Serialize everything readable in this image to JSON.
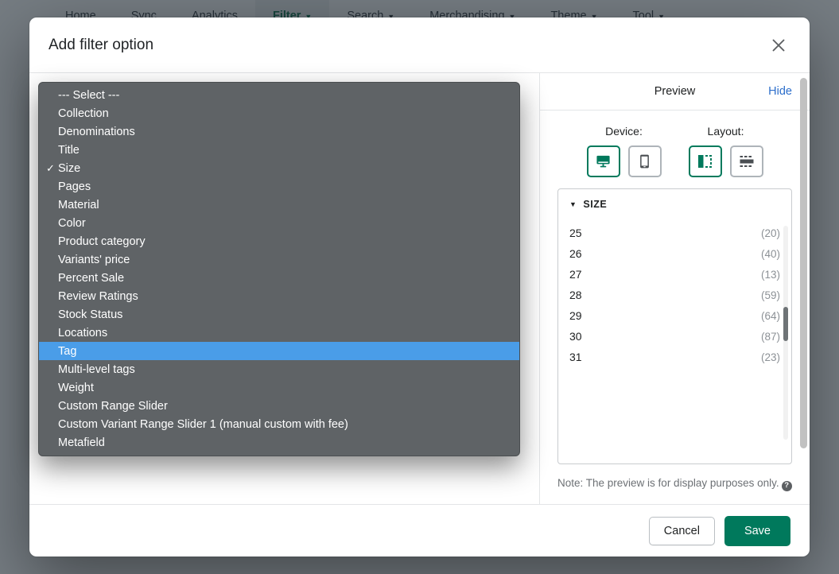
{
  "app": {
    "nav": [
      {
        "label": "Home",
        "has_caret": false,
        "active": false
      },
      {
        "label": "Sync",
        "has_caret": false,
        "active": false
      },
      {
        "label": "Analytics",
        "has_caret": false,
        "active": false
      },
      {
        "label": "Filter",
        "has_caret": true,
        "active": true
      },
      {
        "label": "Search",
        "has_caret": true,
        "active": false
      },
      {
        "label": "Merchandising",
        "has_caret": true,
        "active": false
      },
      {
        "label": "Theme",
        "has_caret": true,
        "active": false
      },
      {
        "label": "Tool",
        "has_caret": true,
        "active": false
      }
    ]
  },
  "modal": {
    "title": "Add filter option",
    "close_icon": "close-icon",
    "footer": {
      "cancel_label": "Cancel",
      "save_label": "Save"
    }
  },
  "dropdown": {
    "open": true,
    "selected": "Size",
    "highlighted": "Tag",
    "options": [
      "--- Select ---",
      "Collection",
      "Denominations",
      "Title",
      "Size",
      "Pages",
      "Material",
      "Color",
      "Product category",
      "Variants' price",
      "Percent Sale",
      "Review Ratings",
      "Stock Status",
      "Locations",
      "Tag",
      "Multi-level tags",
      "Weight",
      "Custom Range Slider",
      "Custom Variant Range Slider 1 (manual custom with fee)",
      "Metafield"
    ]
  },
  "preview": {
    "title": "Preview",
    "hide_label": "Hide",
    "device": {
      "label": "Device:",
      "options": [
        {
          "name": "desktop-icon",
          "selected": true
        },
        {
          "name": "mobile-icon",
          "selected": false
        }
      ]
    },
    "layout": {
      "label": "Layout:",
      "options": [
        {
          "name": "sidebar-layout-icon",
          "selected": true
        },
        {
          "name": "horizontal-layout-icon",
          "selected": false
        }
      ]
    },
    "facet": {
      "title": "SIZE",
      "expanded": true,
      "rows": [
        {
          "value": "25",
          "count": "(20)"
        },
        {
          "value": "26",
          "count": "(40)"
        },
        {
          "value": "27",
          "count": "(13)"
        },
        {
          "value": "28",
          "count": "(59)"
        },
        {
          "value": "29",
          "count": "(64)"
        },
        {
          "value": "30",
          "count": "(87)"
        },
        {
          "value": "31",
          "count": "(23)"
        }
      ]
    },
    "note": "Note: The preview is for display purposes only.",
    "note_help_icon": "help-icon"
  },
  "colors": {
    "brand_green": "#00795c",
    "link_blue": "#2c6ecb",
    "dropdown_bg": "#5f6366",
    "highlight_blue": "#4a9de8",
    "focus_blue": "#1a73e8"
  }
}
